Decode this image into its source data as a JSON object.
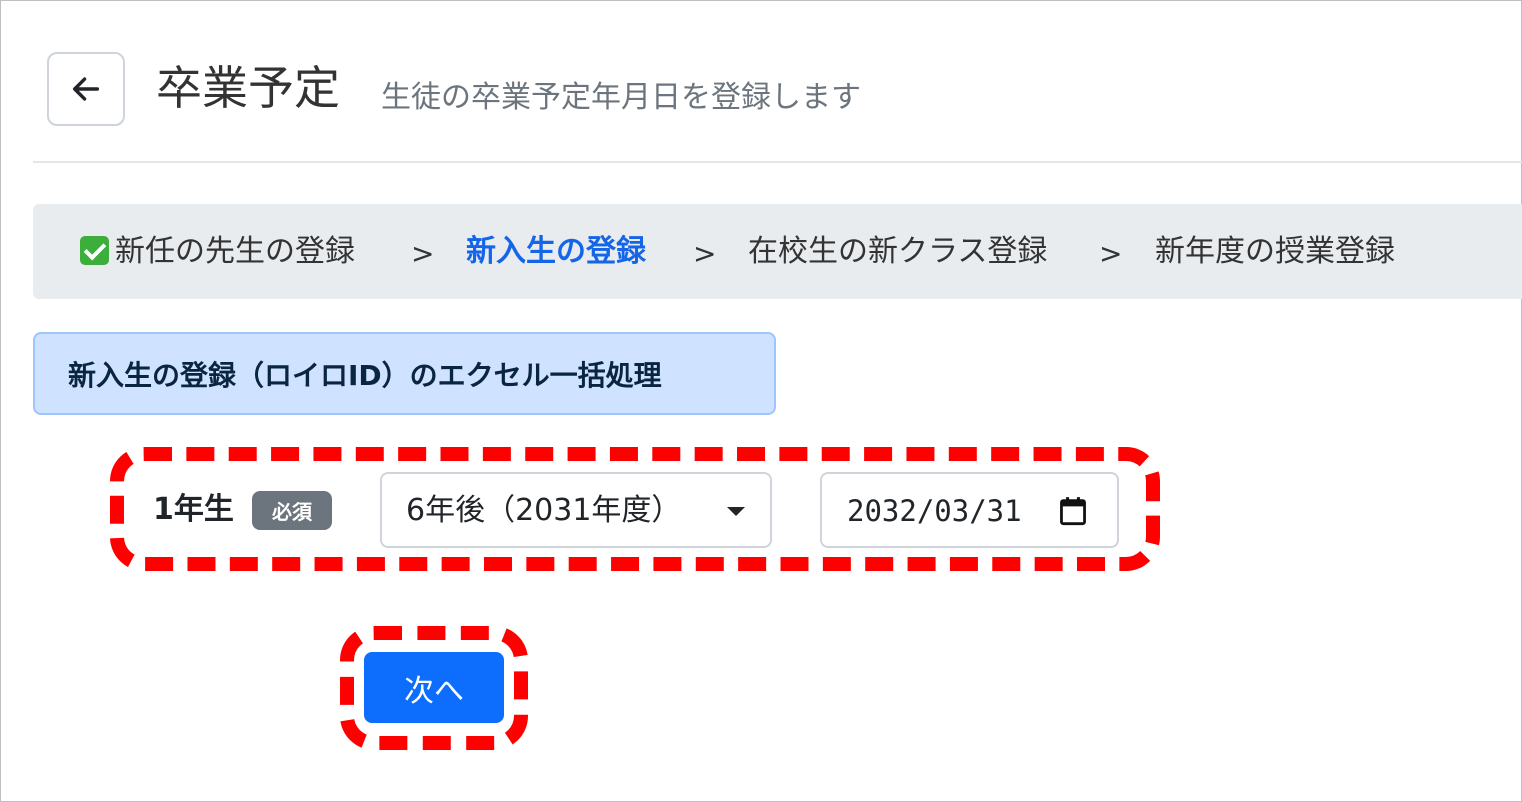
{
  "header": {
    "title": "卒業予定",
    "subtitle": "生徒の卒業予定年月日を登録します"
  },
  "steps": [
    {
      "label": "新任の先生の登録",
      "status": "done",
      "icon": "check-icon"
    },
    {
      "label": "新入生の登録",
      "status": "active"
    },
    {
      "label": "在校生の新クラス登録",
      "status": "pending"
    },
    {
      "label": "新年度の授業登録",
      "status": "pending"
    }
  ],
  "step_separator": ">",
  "panel": {
    "title": "新入生の登録（ロイロID）のエクセル一括処理"
  },
  "form": {
    "grade_label": "1年生",
    "required_badge": "必須",
    "graduation_select": "6年後（2031年度）",
    "graduation_date": "2032/03/31"
  },
  "next_button": "次へ",
  "colors": {
    "primary": "#0d6efd",
    "active_step": "#1565e8",
    "highlight": "#ff0000",
    "panel_bg": "#cfe2ff"
  }
}
